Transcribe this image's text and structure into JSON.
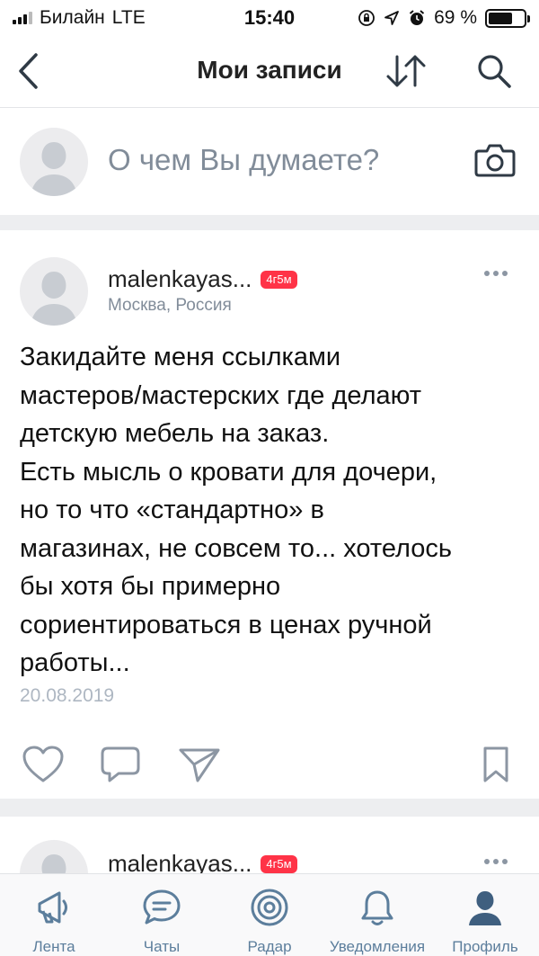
{
  "status_bar": {
    "carrier": "Билайн",
    "network": "LTE",
    "time": "15:40",
    "battery": "69 %",
    "battery_level": 0.69
  },
  "nav": {
    "title": "Мои записи",
    "icons": [
      "back-chevron",
      "sort-arrows",
      "search"
    ]
  },
  "composer": {
    "placeholder": "О чем Вы думаете?",
    "icons": [
      "avatar-placeholder",
      "camera"
    ]
  },
  "posts": [
    {
      "author": "malenkayas...",
      "badge": "4г5м",
      "location": "Москва, Россия",
      "text": "Закидайте меня ссылками\nмастеров/мастерских где делают\nдетскую мебель на заказ.\nЕсть мысль о кровати для дочери,\nно то что «стандартно» в\nмагазинах, не совсем то... хотелось\nбы хотя бы примерно\nсориентироваться в ценах ручной\nработы...",
      "date": "20.08.2019",
      "actions": [
        "like",
        "comment",
        "share",
        "bookmark"
      ]
    },
    {
      "author": "malenkayas...",
      "badge": "4г5м"
    }
  ],
  "tab_bar": {
    "items": [
      {
        "label": "Лента",
        "icon": "megaphone"
      },
      {
        "label": "Чаты",
        "icon": "chat-bubble"
      },
      {
        "label": "Радар",
        "icon": "radar"
      },
      {
        "label": "Уведомления",
        "icon": "bell"
      },
      {
        "label": "Профиль",
        "icon": "person"
      }
    ],
    "active_index": 4
  },
  "colors": {
    "accent": "#5c7e9c",
    "badge": "#ff3347",
    "muted_text": "#818c99",
    "separator": "#edeef0"
  }
}
